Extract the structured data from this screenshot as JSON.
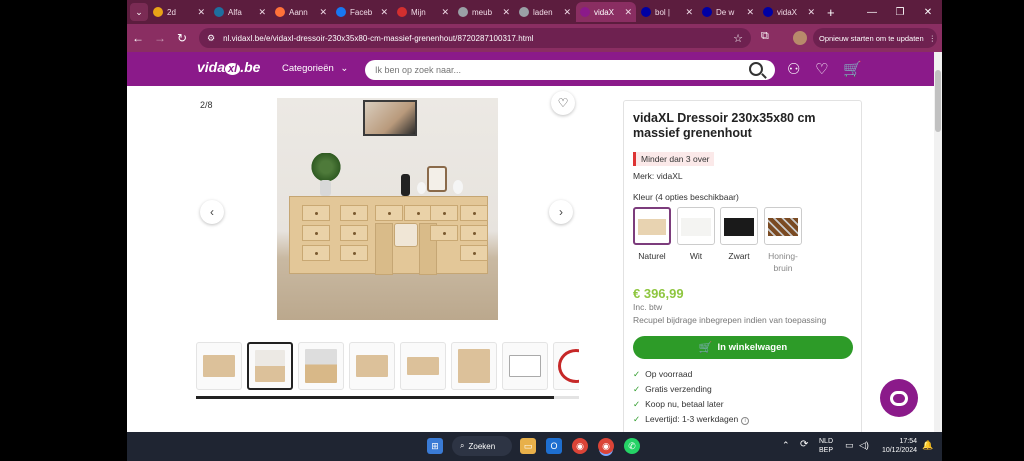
{
  "browser": {
    "tabs": [
      {
        "label": "2d",
        "color": "#e8a317"
      },
      {
        "label": "Alfa",
        "color": "#1e6f9f"
      },
      {
        "label": "Aann",
        "color": "#ff7139"
      },
      {
        "label": "Faceb",
        "color": "#1877f2"
      },
      {
        "label": "Mijn",
        "color": "#d32f2f"
      },
      {
        "label": "meub",
        "color": "#9aa0a6"
      },
      {
        "label": "laden",
        "color": "#9aa0a6"
      },
      {
        "label": "vidaX",
        "color": "#8b1a8a"
      },
      {
        "label": "bol |",
        "color": "#0000a4"
      },
      {
        "label": "De w",
        "color": "#0000a4"
      },
      {
        "label": "vidaX",
        "color": "#0000a4"
      }
    ],
    "url": "nl.vidaxl.be/e/vidaxl-dressoir-230x35x80-cm-massief-grenenhout/8720287100317.html",
    "restart_label": "Opnieuw starten om te updaten"
  },
  "site": {
    "logo": "vidaxl",
    "logo_suffix": ".be",
    "categories_label": "Categorieën",
    "search_placeholder": "Ik ben op zoek naar..."
  },
  "gallery": {
    "counter": "2/8",
    "thumbnails": 8,
    "selected_thumbnail": 2
  },
  "product": {
    "title": "vidaXL Dressoir 230x35x80 cm massief grenenhout",
    "stock": "Minder dan 3 over",
    "brand": "Merk: vidaXL",
    "color_label": "Kleur (4 opties beschikbaar)",
    "colors": [
      {
        "name": "Naturel",
        "hex": "#e8d3b1",
        "selected": true
      },
      {
        "name": "Wit",
        "hex": "#f4f4f2",
        "selected": false
      },
      {
        "name": "Zwart",
        "hex": "#1a1a1a",
        "selected": false
      },
      {
        "name": "Honing-",
        "name2": "bruin",
        "hex": "#7a4a22",
        "selected": false
      }
    ],
    "price": "€ 396,99",
    "vat": "Inc. btw",
    "recupel": "Recupel bijdrage inbegrepen indien van toepassing",
    "cart_label": "In winkelwagen",
    "usps": [
      "Op voorraad",
      "Gratis verzending",
      "Koop nu, betaal later",
      "Levertijd: 1-3 werkdagen"
    ]
  },
  "taskbar": {
    "search_label": "Zoeken",
    "lang1": "NLD",
    "lang2": "BEP",
    "time": "17:54",
    "date": "10/12/2024"
  }
}
